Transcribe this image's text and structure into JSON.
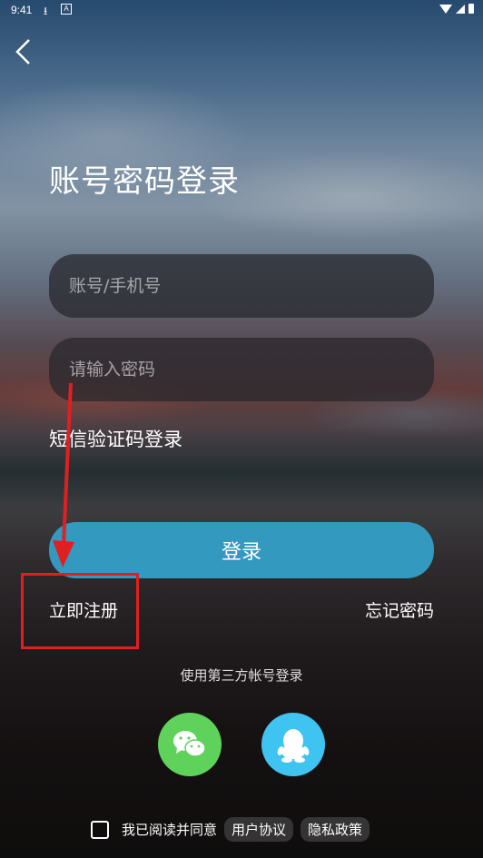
{
  "status_bar": {
    "time": "9:41"
  },
  "header": {
    "title": "账号密码登录"
  },
  "form": {
    "account_placeholder": "账号/手机号",
    "password_placeholder": "请输入密码",
    "sms_login_label": "短信验证码登录",
    "login_button_label": "登录",
    "register_label": "立即注册",
    "forgot_password_label": "忘记密码"
  },
  "third_party": {
    "label": "使用第三方帐号登录",
    "providers": [
      {
        "icon": "wechat-icon",
        "color": "#5fd25c"
      },
      {
        "icon": "qq-icon",
        "color": "#3fc3f0"
      }
    ]
  },
  "agreement": {
    "prefix": "我已阅读并同意",
    "user_agreement": "用户协议",
    "privacy_policy": "隐私政策"
  },
  "annotation": {
    "color": "#e02020"
  }
}
